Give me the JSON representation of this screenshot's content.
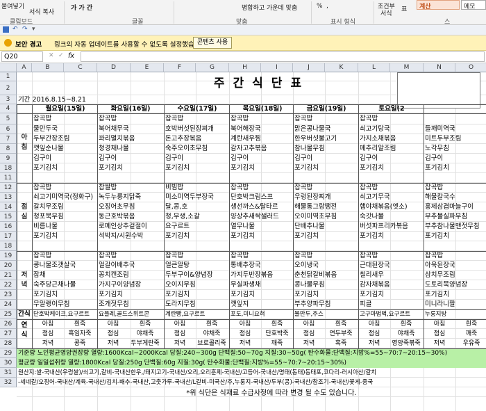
{
  "ribbon": {
    "paste": "붙여넣기",
    "format_painter": "서식 복사",
    "clipboard_group": "클립보드",
    "font_sample": "가 가 간",
    "font_group": "글꼴",
    "align_group": "맞춤",
    "merge_label": "병합하고 가운데 맞춤",
    "number_group": "표시 형식",
    "percent": "%",
    "comma": ",",
    "conditional": "조건부",
    "conditional2": "서식",
    "table_fmt": "표",
    "calc_label": "계산",
    "memo_label": "메모",
    "style_group": "스"
  },
  "security": {
    "title": "보안 경고",
    "message": "링크의 자동 업데이트를 사용할 수 없도록 설정했습니다.",
    "button": "콘텐츠 사용"
  },
  "formula_bar": {
    "name_box": "Q20",
    "fx": "fx",
    "value": ""
  },
  "columns": [
    "A",
    "B",
    "C",
    "D",
    "E",
    "F",
    "G",
    "H",
    "I",
    "J",
    "K",
    "L",
    "M",
    "N",
    "O"
  ],
  "sheet": {
    "title": "주간식단표",
    "period": "기간  2016.8.15~8.21",
    "days": [
      "월요일(15일)",
      "화요일(16일)",
      "수요일(17일)",
      "목요일(18일)",
      "금요일(19일)",
      "토요일(2"
    ],
    "breakfast_label": [
      "아",
      "침"
    ],
    "lunch_label": [
      "점",
      "심"
    ],
    "dinner_label": [
      "저",
      "녁"
    ],
    "snack_label": "간식",
    "note_label": [
      "연",
      "식"
    ],
    "breakfast": [
      [
        "잡곡밥",
        "잡곡밥",
        "잡곡밥",
        "잡곡밥",
        "잡곡밥",
        "잡곡밥",
        ""
      ],
      [
        "물만두국",
        "북어채무국",
        "호박버섯된장찌개",
        "북어해장국",
        "맑은콩나물국",
        "쇠고기탕국",
        "들깨미역국"
      ],
      [
        "두부간장조림",
        "꽈리멸치볶음",
        "돈고추장볶음",
        "계란새우찜",
        "한우버섯불고기",
        "가지소채볶음",
        "미트두부조림"
      ],
      [
        "깻잎순나물",
        "청경채나물",
        "숙주오이초무침",
        "감자고추볶음",
        "참나물무침",
        "메추리알조림",
        "노각무침"
      ],
      [
        "김구이",
        "김구이",
        "김구이",
        "김구이",
        "김구이",
        "김구이",
        "김구이"
      ],
      [
        "포기김치",
        "포기김치",
        "포기김치",
        "포기김치",
        "포기김치",
        "포기김치",
        "포기김치"
      ]
    ],
    "lunch": [
      [
        "잡곡밥",
        "찹쌀밥",
        "비빔밥",
        "잡곡밥",
        "잡곡밥",
        "잡곡밥",
        "잡곡밥"
      ],
      [
        "쇠고기미역국(정화구)",
        "녹두누룽지닭죽",
        "미소미역두부장국",
        "단호박크림스프",
        "우렁된장찌개",
        "쇠고기무국",
        "해물칼국수"
      ],
      [
        "갈치무조림",
        "오징어초무침",
        "달,콩,호",
        "생선까스&탈타르",
        "해물통그랑땡전",
        "햄야채볶음(엣소)",
        "홍제삼겹마늘구이"
      ],
      [
        "청포묵무침",
        "동근호박볶음",
        "청,무생,소갈",
        "양상추새싹샐러드",
        "오이미역초무침",
        "숙갓나물",
        "부추물실파무침"
      ],
      [
        "비름나물",
        "로메인상추겉절이",
        "요구르트",
        "열무나물",
        "단배추나물",
        "버섯파프리카볶음",
        "부추참나물맨젓무침"
      ],
      [
        "포기김치",
        "석박지/시원수박",
        "포기김치",
        "포기김치",
        "포기김치",
        "포기김치",
        "포기김치"
      ]
    ],
    "dinner": [
      [
        "잡곡밥",
        "잡곡밥",
        "잡곡밥",
        "잡곡밥",
        "잡곡밥",
        "잡곡밥",
        "잡곡밥"
      ],
      [
        "콩나물조갯살국",
        "얼갈이배추국",
        "얼큰알탕",
        "통배추장국",
        "오이냉국",
        "근대된장국",
        "아욱된장국"
      ],
      [
        "잡채",
        "꽁치캔조림",
        "두부구이&양념장",
        "가지두반장볶음",
        "춘천닭갈비볶음",
        "칠리새우",
        "삼치무조림"
      ],
      [
        "숙주당근채나물",
        "가지구이양념장",
        "오이지무침",
        "무실파생채",
        "콩나물무침",
        "감자채볶음",
        "도토리묵양념장"
      ],
      [
        "포기김치",
        "포기김치",
        "포기김치",
        "포기김치",
        "포기김치",
        "포기김치",
        "포기김치"
      ],
      [
        "무말랭이무침",
        "조개젓무침",
        "도라지무침",
        "깻잎지",
        "부추양파무침",
        "피클",
        "미니라니팔"
      ]
    ],
    "snack": [
      "단호박케이크,요구르트",
      "요플레,골드스위트콘",
      "계란빵,요구르트",
      "포도,미니요혀",
      "물만두,주스",
      "고구마범벅,요구르트",
      "누룽지탕"
    ],
    "note_rows": [
      [
        "아침",
        "흰죽",
        "아침",
        "흰죽",
        "아침",
        "흰죽",
        "아침",
        "흰죽",
        "아침",
        "흰죽",
        "아침",
        "흰죽",
        "아침",
        "흰죽"
      ],
      [
        "점심",
        "흑임자죽",
        "점심",
        "야채죽",
        "점심",
        "야채죽",
        "점심",
        "단호박죽",
        "점심",
        "연두부죽",
        "점심",
        "야채죽",
        "점심",
        "깨죽"
      ],
      [
        "저녁",
        "콩죽",
        "저녁",
        "두부게란죽",
        "저녁",
        "브로콜리죽",
        "저녁",
        "깨죽",
        "저녁",
        "흑죽",
        "저녁",
        "영양죽볶죽",
        "저녁",
        "우유죽"
      ]
    ],
    "nutrition1": "기준량 노인평균영양권장량  열량:1600Kcal~2000Kcal 당질:240~300g 단백질:50~70g 지질:30~50g( 탄수화물:단백질:지방%=55~70:7~20:15~30%)",
    "nutrition2": "평균량 일일섭취량 열량:1800Kcal 당질:250g 단백질:60g 지질:30g( 탄수화물:단백질:지방%=55~70:7~20:15~30%)",
    "origin1": "원산지:쌀-국내산(우렁쌀)/쇠고기,갈비-국내산한우,/돼지고기-국내산/오리,오리훈제-국내산/고등어-국내산/명태(동태)동태포,코다리-러시아산/갈치",
    "origin2": "-세네갈/오징어-국내산/계육-국내산/김치-배추-국내산,고춧가루-국내산/L갈비-미국산/주,누룽지-국내산/두부(콩)-국내산/참조기-국내산/꽃게-중국",
    "footer": "*위 식단은 식재료 수급사정에 따라 변경 될 수도 있습니다."
  },
  "rows": [
    "1",
    "2",
    "3",
    "4",
    "5",
    "6",
    "7",
    "8",
    "9",
    "18",
    "11",
    "12",
    "13",
    "14",
    "15",
    "16",
    "17",
    "18",
    "19",
    "20",
    "21",
    "22",
    "23",
    "24",
    "25",
    "26",
    "27",
    "28",
    "29",
    "30",
    "31",
    "32"
  ]
}
